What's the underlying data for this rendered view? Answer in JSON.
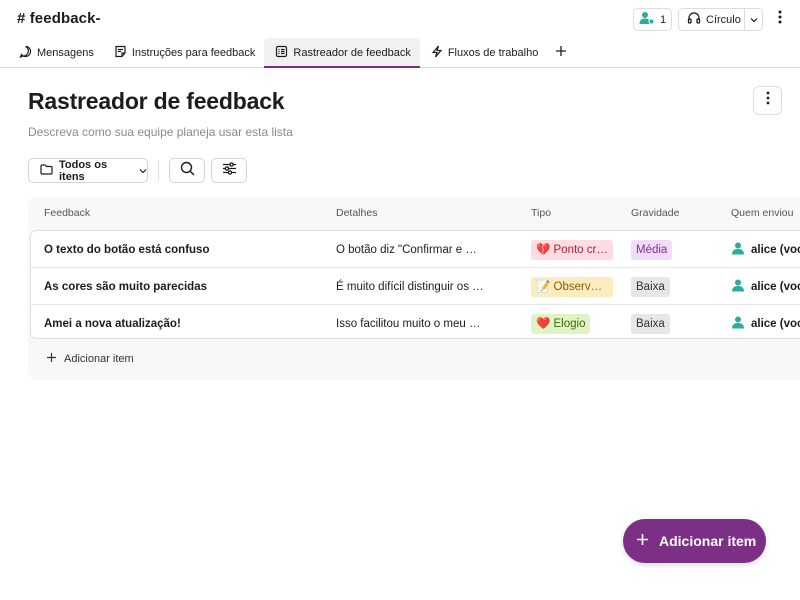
{
  "header": {
    "channel_name": "# feedback-",
    "members_count": "1",
    "huddle_label": "Círculo"
  },
  "tabs": [
    {
      "label": "Mensagens",
      "icon": "chat-bubble-icon"
    },
    {
      "label": "Instruções para feedback",
      "icon": "canvas-icon"
    },
    {
      "label": "Rastreador de feedback",
      "icon": "list-icon",
      "active": true
    },
    {
      "label": "Fluxos de trabalho",
      "icon": "lightning-icon"
    }
  ],
  "page": {
    "title": "Rastreador de feedback",
    "description": "Descreva como sua equipe planeja usar esta lista"
  },
  "toolbar": {
    "filter_label": "Todos os itens"
  },
  "table": {
    "columns": [
      "Feedback",
      "Detalhes",
      "Tipo",
      "Gravidade",
      "Quem enviou"
    ],
    "rows": [
      {
        "feedback": "O texto do botão está confuso",
        "details": "O botão diz \"Confirmar e …",
        "tipo": "💔 Ponto crí…",
        "tipo_color": "#fcdde2",
        "gravidade": "Média",
        "gravidade_color": "#f1dcf7",
        "who": "alice (voc"
      },
      {
        "feedback": "As cores são muito parecidas",
        "details": "É muito difícil distinguir os …",
        "tipo": "📝 Observa…",
        "tipo_color": "#fdecc0",
        "gravidade": "Baixa",
        "gravidade_color": "#e6e6e6",
        "who": "alice (voc"
      },
      {
        "feedback": "Amei a nova atualização!",
        "details": "Isso facilitou muito o meu …",
        "tipo": "❤️ Elogio",
        "tipo_color": "#dff3c4",
        "gravidade": "Baixa",
        "gravidade_color": "#e6e6e6",
        "who": "alice (voc"
      }
    ],
    "add_item_label": "Adicionar item"
  },
  "fab": {
    "label": "Adicionar item"
  },
  "colors": {
    "accent": "#7c3085",
    "avatar": "#2bac9e"
  }
}
